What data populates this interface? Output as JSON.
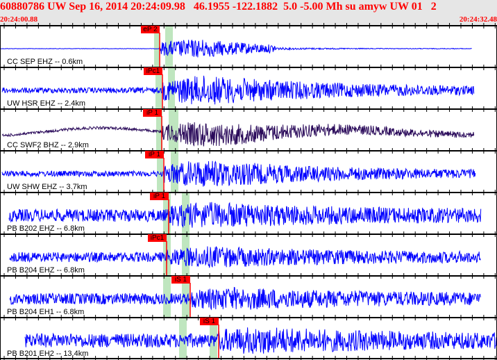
{
  "header": {
    "title": "60880786 UW Sep 16, 2014 20:24:09.98   46.1955 -122.1882  5.0 -5.00 Mh su amyw UW 01   2",
    "start_time": "20:24:00.88",
    "end_time": "20:24:32.48"
  },
  "colors": {
    "trace": "#0000ff",
    "trace_alt": "#2a0a5a",
    "pick": "#ff0000",
    "window": "#bfe6bf"
  },
  "traces": [
    {
      "label": "CC SEP EHZ -- 0.6km",
      "pick": "eP 2"
    },
    {
      "label": "UW HSR EHZ -- 2.4km",
      "pick": "iPc1"
    },
    {
      "label": "CC SWF2 BHZ -- 2.9km",
      "pick": "iP 1"
    },
    {
      "label": "UW SHW EHZ -- 3.7km",
      "pick": "iP 1"
    },
    {
      "label": "PB B202 EHZ -- 6.8km",
      "pick": "iP 1"
    },
    {
      "label": "PB B204 EHZ -- 6.8km",
      "pick": "iPc1"
    },
    {
      "label": "PB B204 EH1 -- 6.8km",
      "pick": "iS 1"
    },
    {
      "label": "PB B201 EH2 -- 13.4km",
      "pick": "iS 1"
    }
  ]
}
